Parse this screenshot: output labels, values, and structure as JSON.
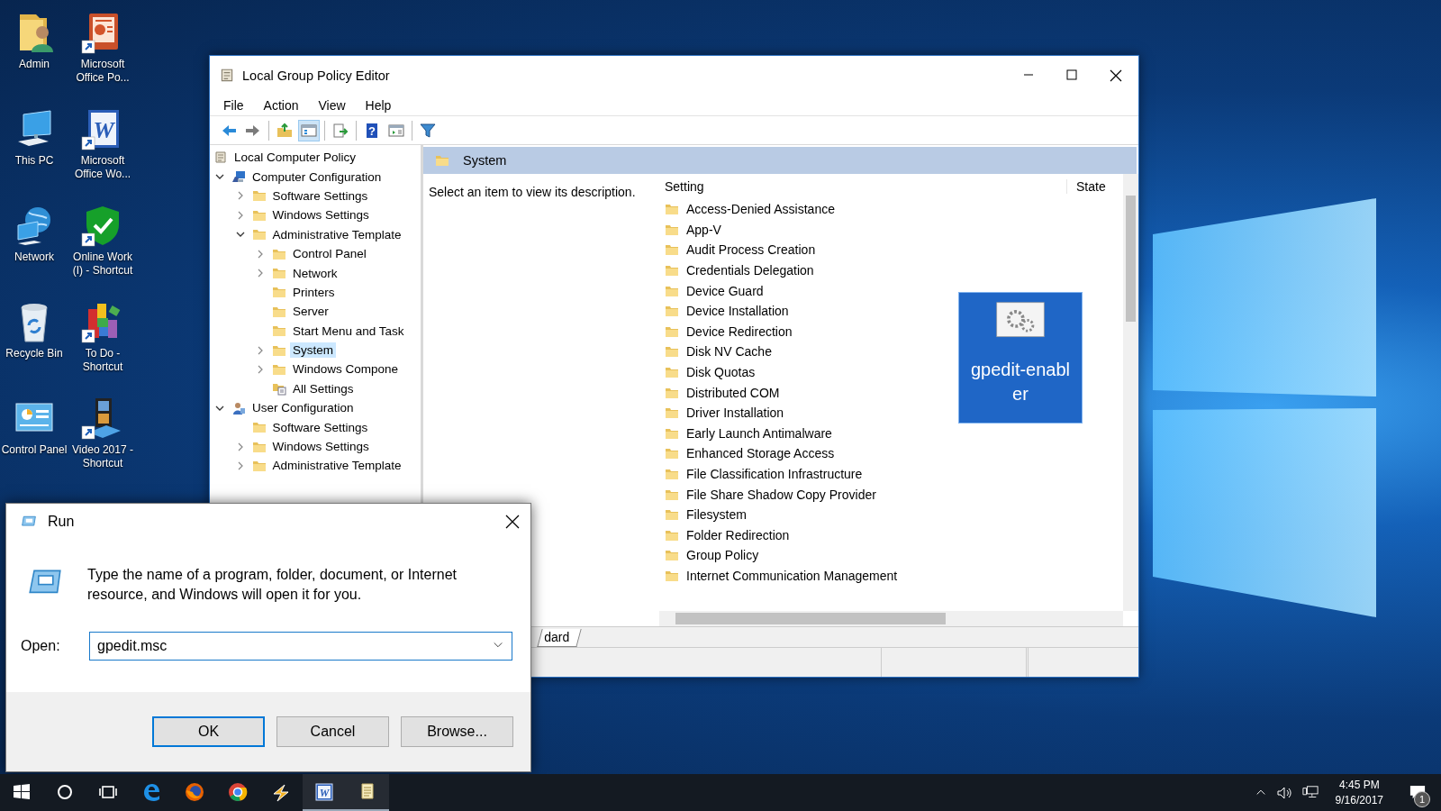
{
  "desktop_icons": [
    {
      "label": "Admin",
      "kind": "user-folder",
      "shortcut": false,
      "selected": false
    },
    {
      "label": "This PC",
      "kind": "computer",
      "shortcut": false,
      "selected": false
    },
    {
      "label": "Network",
      "kind": "network",
      "shortcut": false,
      "selected": false
    },
    {
      "label": "Recycle Bin",
      "kind": "recycle-bin",
      "shortcut": false,
      "selected": false
    },
    {
      "label": "Control Panel",
      "kind": "control-panel",
      "shortcut": false,
      "selected": false
    },
    {
      "label": "Microsoft Office Po...",
      "kind": "slides",
      "shortcut": true,
      "selected": false
    },
    {
      "label": "Microsoft Office Wo...",
      "kind": "word",
      "glyph": "W",
      "shortcut": true,
      "selected": false
    },
    {
      "label": "Online Work (I) - Shortcut",
      "kind": "shield",
      "shortcut": true,
      "selected": false
    },
    {
      "label": "To Do - Shortcut",
      "kind": "blocks",
      "shortcut": true,
      "selected": false
    },
    {
      "label": "Video 2017 - Shortcut",
      "kind": "video",
      "shortcut": true,
      "selected": false
    }
  ],
  "gpe_window": {
    "title": "Local Group Policy Editor",
    "menu": [
      "File",
      "Action",
      "View",
      "Help"
    ],
    "toolbar": [
      [
        {
          "kind": "back",
          "pressed": false
        },
        {
          "kind": "forward",
          "pressed": false
        }
      ],
      [
        {
          "kind": "up-folder",
          "pressed": false
        },
        {
          "kind": "show-tree",
          "pressed": true
        }
      ],
      [
        {
          "kind": "export",
          "pressed": false
        }
      ],
      [
        {
          "kind": "help",
          "glyph": "?",
          "pressed": false
        },
        {
          "kind": "panel",
          "pressed": false
        }
      ],
      [
        {
          "kind": "filter",
          "pressed": false
        }
      ]
    ],
    "tree": [
      {
        "label": "Local Computer Policy",
        "kind": "policy",
        "selected": false,
        "children": [
          {
            "label": "Computer Configuration",
            "kind": "computer",
            "expanded": true,
            "selected": false,
            "children": [
              {
                "label": "Software Settings",
                "kind": "folder",
                "expanded": false,
                "selected": false
              },
              {
                "label": "Windows Settings",
                "kind": "folder",
                "expanded": false,
                "selected": false
              },
              {
                "label": "Administrative Template",
                "kind": "folder",
                "expanded": true,
                "selected": false,
                "children": [
                  {
                    "label": "Control Panel",
                    "kind": "folder",
                    "expanded": false,
                    "selected": false
                  },
                  {
                    "label": "Network",
                    "kind": "folder",
                    "expanded": false,
                    "selected": false
                  },
                  {
                    "label": "Printers",
                    "kind": "folder",
                    "selected": false
                  },
                  {
                    "label": "Server",
                    "kind": "folder",
                    "selected": false
                  },
                  {
                    "label": "Start Menu and Task",
                    "kind": "folder",
                    "selected": false
                  },
                  {
                    "label": "System",
                    "kind": "folder",
                    "expanded": false,
                    "selected": true
                  },
                  {
                    "label": "Windows Compone",
                    "kind": "folder",
                    "expanded": false,
                    "selected": false
                  },
                  {
                    "label": "All Settings",
                    "kind": "settings",
                    "selected": false
                  }
                ]
              }
            ]
          },
          {
            "label": "User Configuration",
            "kind": "user",
            "expanded": true,
            "selected": false,
            "children": [
              {
                "label": "Software Settings",
                "kind": "folder",
                "selected": false
              },
              {
                "label": "Windows Settings",
                "kind": "folder",
                "expanded": false,
                "selected": false
              },
              {
                "label": "Administrative Template",
                "kind": "folder",
                "expanded": false,
                "selected": false
              }
            ]
          }
        ]
      }
    ],
    "header": "System",
    "description": "Select an item to view its description.",
    "columns": [
      "Setting",
      "State"
    ],
    "settings": [
      "Access-Denied Assistance",
      "App-V",
      "Audit Process Creation",
      "Credentials Delegation",
      "Device Guard",
      "Device Installation",
      "Device Redirection",
      "Disk NV Cache",
      "Disk Quotas",
      "Distributed COM",
      "Driver Installation",
      "Early Launch Antimalware",
      "Enhanced Storage Access",
      "File Classification Infrastructure",
      "File Share Shadow Copy Provider",
      "Filesystem",
      "Folder Redirection",
      "Group Policy",
      "Internet Communication Management"
    ],
    "tab": "dard"
  },
  "dragged_icon": {
    "label": "gpedit-enabler",
    "selected": true
  },
  "run_dialog": {
    "title": "Run",
    "message": "Type the name of a program, folder, document, or Internet resource, and Windows will open it for you.",
    "open_label": "Open:",
    "value": "gpedit.msc",
    "buttons": [
      {
        "label": "OK",
        "default": true
      },
      {
        "label": "Cancel",
        "default": false
      },
      {
        "label": "Browse...",
        "default": false
      }
    ]
  },
  "taskbar": {
    "apps": [
      {
        "kind": "start",
        "running": false
      },
      {
        "kind": "search",
        "running": false
      },
      {
        "kind": "task-view",
        "running": false
      },
      {
        "kind": "edge",
        "running": false
      },
      {
        "kind": "firefox",
        "running": false
      },
      {
        "kind": "chrome",
        "running": false
      },
      {
        "kind": "bolt",
        "running": false
      },
      {
        "kind": "word",
        "glyph": "W",
        "running": true
      },
      {
        "kind": "notes",
        "running": true
      }
    ],
    "time": "4:45 PM",
    "date": "9/16/2017",
    "notifications": "1"
  }
}
